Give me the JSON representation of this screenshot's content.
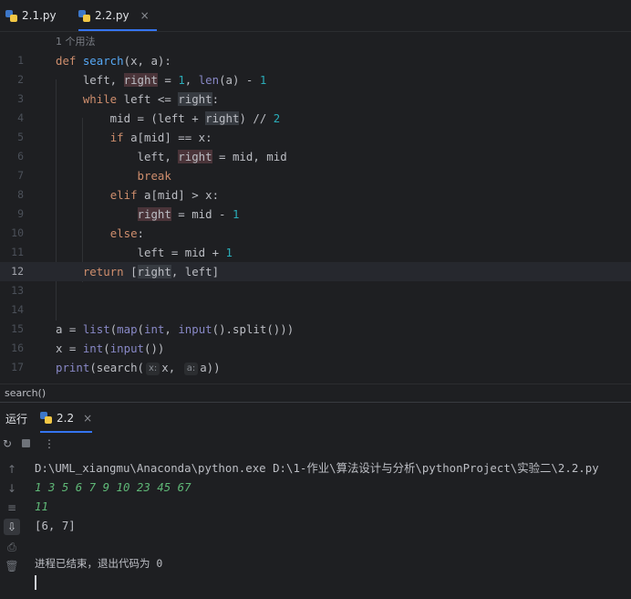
{
  "tabs": [
    {
      "label": "2.1.py",
      "active": false
    },
    {
      "label": "2.2.py",
      "active": true,
      "close": "×"
    }
  ],
  "editor": {
    "usage_hint": "1 个用法",
    "line_numbers": [
      "1",
      "2",
      "3",
      "4",
      "5",
      "6",
      "7",
      "8",
      "9",
      "10",
      "11",
      "12",
      "13",
      "14",
      "15",
      "16",
      "17"
    ],
    "current_line": "12",
    "lines": [
      "def search(x, a):",
      "    left, right = 1, len(a) - 1",
      "    while left <= right:",
      "        mid = (left + right) // 2",
      "        if a[mid] == x:",
      "            left, right = mid, mid",
      "            break",
      "        elif a[mid] > x:",
      "            right = mid - 1",
      "        else:",
      "            left = mid + 1",
      "    return [right, left]",
      "",
      "",
      "a = list(map(int, input().split()))",
      "x = int(input())",
      "print(search( x: x,  a: a))"
    ],
    "param_hints": [
      "x:",
      "a:"
    ]
  },
  "breadcrumb": "search()",
  "run_panel": {
    "label": "运行",
    "tab": "2.2",
    "tab_close": "×",
    "console": {
      "command": "D:\\UML_xiangmu\\Anaconda\\python.exe D:\\1-作业\\算法设计与分析\\pythonProject\\实验二\\2.2.py",
      "input1": "1 3 5 6 7 9 10 23 45 67",
      "input2": "11",
      "output": "[6, 7]",
      "exit_message": "进程已结束，退出代码为 0"
    }
  },
  "icons": {
    "rerun": "rerun-icon",
    "stop": "stop-icon",
    "more": "more-icon",
    "up": "arrow-up-icon",
    "down": "arrow-down-icon",
    "wrap": "soft-wrap-icon",
    "scroll_end": "scroll-to-end-icon",
    "print": "print-icon",
    "trash": "trash-icon"
  },
  "colors": {
    "background": "#1e1f22",
    "keyword": "#cf8e6d",
    "function": "#56a8f5",
    "number": "#2aacb8",
    "builtin": "#8888c6",
    "user_input": "#5fb877",
    "accent": "#3574f0"
  }
}
